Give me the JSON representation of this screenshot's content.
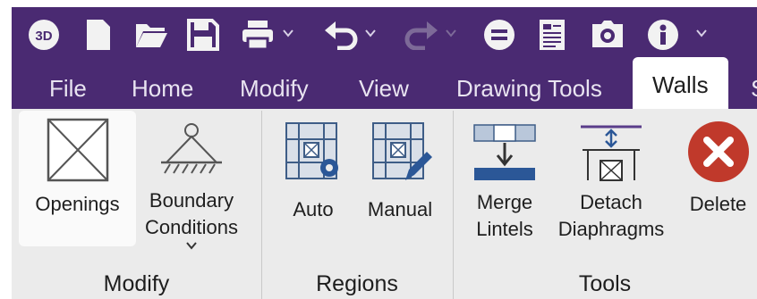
{
  "tabs": [
    {
      "label": "File"
    },
    {
      "label": "Home"
    },
    {
      "label": "Modify"
    },
    {
      "label": "View"
    },
    {
      "label": "Drawing Tools"
    },
    {
      "label": "Walls"
    },
    {
      "label": "S"
    }
  ],
  "active_tab": "Walls",
  "ribbon": {
    "modify": {
      "label": "Modify",
      "openings": "Openings",
      "boundary_line1": "Boundary",
      "boundary_line2": "Conditions"
    },
    "regions": {
      "label": "Regions",
      "auto": "Auto",
      "manual": "Manual"
    },
    "tools": {
      "label": "Tools",
      "merge_line1": "Merge",
      "merge_line2": "Lintels",
      "detach_line1": "Detach",
      "detach_line2": "Diaphragms",
      "delete": "Delete"
    }
  },
  "colors": {
    "titlebar": "#4a2a72",
    "ribbon": "#ebebeb",
    "accent": "#2b5797",
    "delete_red": "#c0392b"
  },
  "qat_icons": [
    "3d-icon",
    "new-file-icon",
    "open-folder-icon",
    "save-icon",
    "print-icon",
    "undo-icon",
    "redo-icon",
    "layers-icon",
    "report-icon",
    "camera-icon",
    "info-icon"
  ]
}
